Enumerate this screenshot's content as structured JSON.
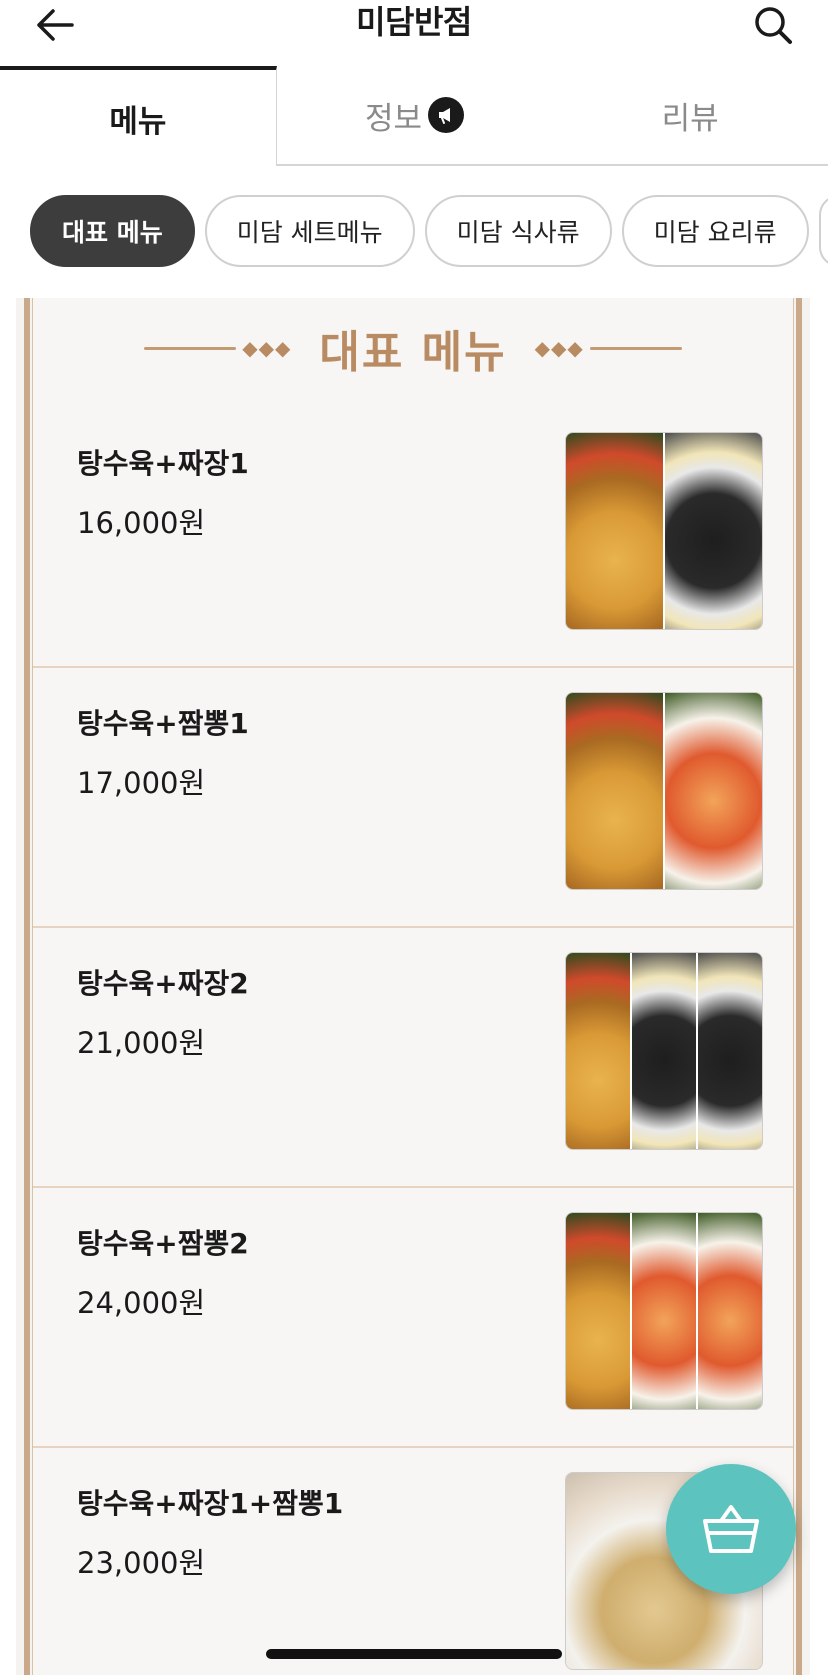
{
  "header": {
    "title": "미담반점",
    "back_icon": "arrow-left-icon",
    "search_icon": "search-icon"
  },
  "tabs": [
    {
      "label": "메뉴",
      "active": true
    },
    {
      "label": "정보",
      "active": false,
      "icon": "megaphone-icon"
    },
    {
      "label": "리뷰",
      "active": false
    }
  ],
  "chips": [
    {
      "label": "대표 메뉴",
      "active": true
    },
    {
      "label": "미담 세트메뉴",
      "active": false
    },
    {
      "label": "미담 식사류",
      "active": false
    },
    {
      "label": "미담 요리류",
      "active": false
    }
  ],
  "section": {
    "title": "대표 메뉴"
  },
  "items": [
    {
      "name": "탕수육+짜장1",
      "price": "16,000원"
    },
    {
      "name": "탕수육+짬뽕1",
      "price": "17,000원"
    },
    {
      "name": "탕수육+짜장2",
      "price": "21,000원"
    },
    {
      "name": "탕수육+짬뽕2",
      "price": "24,000원"
    },
    {
      "name": "탕수육+짜장1+짬뽕1",
      "price": "23,000원"
    }
  ],
  "cart": {
    "icon": "basket-icon",
    "color": "#5cc3be"
  }
}
